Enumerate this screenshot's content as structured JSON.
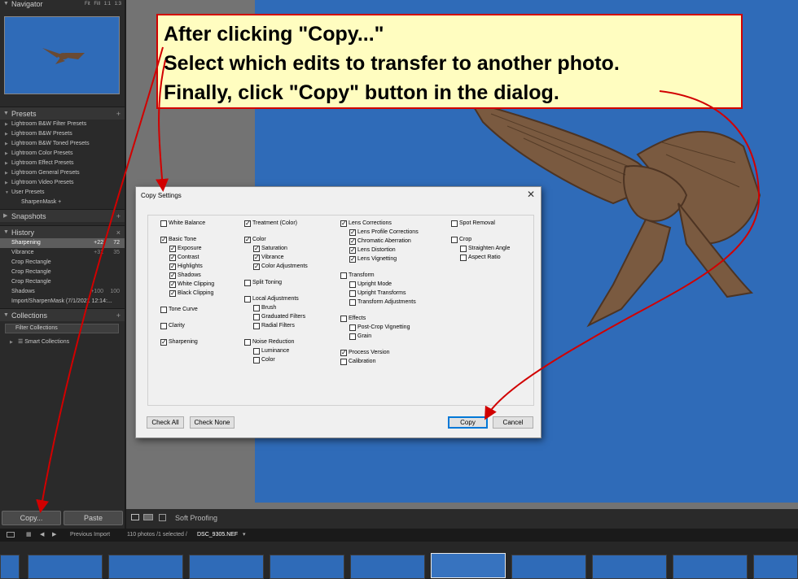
{
  "left_panel": {
    "navigator": {
      "title": "Navigator",
      "zoom_options": "Fit  Fill  1:1  1:3"
    },
    "presets": {
      "title": "Presets",
      "items": [
        "Lightroom B&W Filter Presets",
        "Lightroom B&W Presets",
        "Lightroom B&W Toned Presets",
        "Lightroom Color Presets",
        "Lightroom Effect Presets",
        "Lightroom General Presets",
        "Lightroom Video Presets",
        "User Presets"
      ],
      "sub_item": "SharpenMask"
    },
    "snapshots": {
      "title": "Snapshots"
    },
    "history": {
      "title": "History",
      "items": [
        {
          "label": "Sharpening",
          "v1": "+22",
          "v2": "72"
        },
        {
          "label": "Vibrance",
          "v1": "+31",
          "v2": "35"
        },
        {
          "label": "Crop Rectangle",
          "v1": "",
          "v2": ""
        },
        {
          "label": "Crop Rectangle",
          "v1": "",
          "v2": ""
        },
        {
          "label": "Crop Rectangle",
          "v1": "",
          "v2": ""
        },
        {
          "label": "Shadows",
          "v1": "+100",
          "v2": "100"
        },
        {
          "label": "Import/SharpenMask (7/1/2021 12:14:...",
          "v1": "",
          "v2": ""
        }
      ]
    },
    "collections": {
      "title": "Collections",
      "filter": "Filter Collections",
      "smart": "Smart Collections"
    },
    "copy_button": "Copy...",
    "paste_button": "Paste"
  },
  "toolbar": {
    "soft_proofing": "Soft Proofing"
  },
  "filmstrip_bar": {
    "source": "Previous Import",
    "count": "110 photos /1 selected /",
    "filename": "DSC_9305.NEF"
  },
  "callout": {
    "line1": "After clicking \"Copy...\"",
    "line2": "Select which edits to transfer to another photo.",
    "line3": "Finally, click \"Copy\" button in the dialog."
  },
  "dialog": {
    "title": "Copy Settings",
    "check_all": "Check All",
    "check_none": "Check None",
    "copy": "Copy",
    "cancel": "Cancel",
    "columns": [
      [
        {
          "label": "White Balance",
          "checked": false,
          "indent": false
        },
        {
          "gap": true
        },
        {
          "label": "Basic Tone",
          "checked": true,
          "indent": false
        },
        {
          "label": "Exposure",
          "checked": true,
          "indent": true
        },
        {
          "label": "Contrast",
          "checked": true,
          "indent": true
        },
        {
          "label": "Highlights",
          "checked": true,
          "indent": true
        },
        {
          "label": "Shadows",
          "checked": true,
          "indent": true
        },
        {
          "label": "White Clipping",
          "checked": true,
          "indent": true
        },
        {
          "label": "Black Clipping",
          "checked": true,
          "indent": true
        },
        {
          "gap": true
        },
        {
          "label": "Tone Curve",
          "checked": false,
          "indent": false
        },
        {
          "gap": true
        },
        {
          "label": "Clarity",
          "checked": false,
          "indent": false
        },
        {
          "gap": true
        },
        {
          "label": "Sharpening",
          "checked": true,
          "indent": false
        }
      ],
      [
        {
          "label": "Treatment (Color)",
          "checked": true,
          "indent": false
        },
        {
          "gap": true
        },
        {
          "label": "Color",
          "checked": true,
          "indent": false
        },
        {
          "label": "Saturation",
          "checked": true,
          "indent": true
        },
        {
          "label": "Vibrance",
          "checked": true,
          "indent": true
        },
        {
          "label": "Color Adjustments",
          "checked": true,
          "indent": true
        },
        {
          "gap": true
        },
        {
          "label": "Split Toning",
          "checked": false,
          "indent": false
        },
        {
          "gap": true
        },
        {
          "label": "Local Adjustments",
          "checked": false,
          "indent": false
        },
        {
          "label": "Brush",
          "checked": false,
          "indent": true
        },
        {
          "label": "Graduated Filters",
          "checked": false,
          "indent": true
        },
        {
          "label": "Radial Filters",
          "checked": false,
          "indent": true
        },
        {
          "gap": true
        },
        {
          "label": "Noise Reduction",
          "checked": false,
          "indent": false
        },
        {
          "label": "Luminance",
          "checked": false,
          "indent": true
        },
        {
          "label": "Color",
          "checked": false,
          "indent": true
        }
      ],
      [
        {
          "label": "Lens Corrections",
          "checked": true,
          "indent": false
        },
        {
          "label": "Lens Profile Corrections",
          "checked": true,
          "indent": true
        },
        {
          "label": "Chromatic Aberration",
          "checked": true,
          "indent": true
        },
        {
          "label": "Lens Distortion",
          "checked": true,
          "indent": true
        },
        {
          "label": "Lens Vignetting",
          "checked": true,
          "indent": true
        },
        {
          "gap": true
        },
        {
          "label": "Transform",
          "checked": false,
          "indent": false
        },
        {
          "label": "Upright Mode",
          "checked": false,
          "indent": true
        },
        {
          "label": "Upright Transforms",
          "checked": false,
          "indent": true
        },
        {
          "label": "Transform Adjustments",
          "checked": false,
          "indent": true
        },
        {
          "gap": true
        },
        {
          "label": "Effects",
          "checked": false,
          "indent": false
        },
        {
          "label": "Post-Crop Vignetting",
          "checked": false,
          "indent": true
        },
        {
          "label": "Grain",
          "checked": false,
          "indent": true
        },
        {
          "gap": true
        },
        {
          "label": "Process Version",
          "checked": true,
          "indent": false
        },
        {
          "label": "Calibration",
          "checked": false,
          "indent": false
        }
      ],
      [
        {
          "label": "Spot Removal",
          "checked": false,
          "indent": false
        },
        {
          "gap": true
        },
        {
          "label": "Crop",
          "checked": false,
          "indent": false
        },
        {
          "label": "Straighten Angle",
          "checked": false,
          "indent": true
        },
        {
          "label": "Aspect Ratio",
          "checked": false,
          "indent": true
        }
      ]
    ]
  },
  "colors": {
    "annotation_red": "#d10000",
    "callout_bg": "#fffdc0",
    "sky_blue": "#2f6bb8"
  },
  "icons": [
    "navigator-thumbnail",
    "hawk-photo",
    "close-icon",
    "checkbox-icon",
    "arrow-annotation"
  ]
}
